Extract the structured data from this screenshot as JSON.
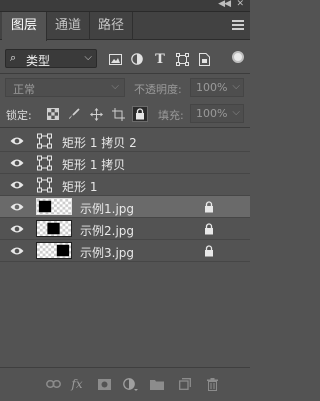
{
  "tabs": [
    {
      "label": "图层",
      "active": true
    },
    {
      "label": "通道",
      "active": false
    },
    {
      "label": "路径",
      "active": false
    }
  ],
  "filter": {
    "kind_label": "类型",
    "icons": [
      "image-filter-icon",
      "adjustment-filter-icon",
      "type-filter-icon",
      "shape-filter-icon",
      "smart-object-filter-icon"
    ],
    "type_glyph": "T"
  },
  "blend": {
    "mode": "正常",
    "opacity_label": "不透明度:",
    "opacity_value": "100%"
  },
  "lock": {
    "label": "锁定:",
    "fill_label": "填充:",
    "fill_value": "100%"
  },
  "layers": [
    {
      "name": "矩形 1 拷贝 2",
      "kind": "shape",
      "visible": true,
      "locked": false,
      "selected": false
    },
    {
      "name": "矩形 1 拷贝",
      "kind": "shape",
      "visible": true,
      "locked": false,
      "selected": false
    },
    {
      "name": "矩形 1",
      "kind": "shape",
      "visible": true,
      "locked": false,
      "selected": false
    },
    {
      "name": "示例1.jpg",
      "kind": "image",
      "visible": true,
      "locked": true,
      "selected": true
    },
    {
      "name": "示例2.jpg",
      "kind": "image",
      "visible": true,
      "locked": true,
      "selected": false
    },
    {
      "name": "示例3.jpg",
      "kind": "image",
      "visible": true,
      "locked": true,
      "selected": false
    }
  ],
  "footer": {
    "fx_label": "fx"
  },
  "colors": {
    "panel_bg": "#535353",
    "selected_row": "#6a6a6a",
    "text": "#e8e8e8",
    "disabled_text": "#9a9a9a"
  }
}
